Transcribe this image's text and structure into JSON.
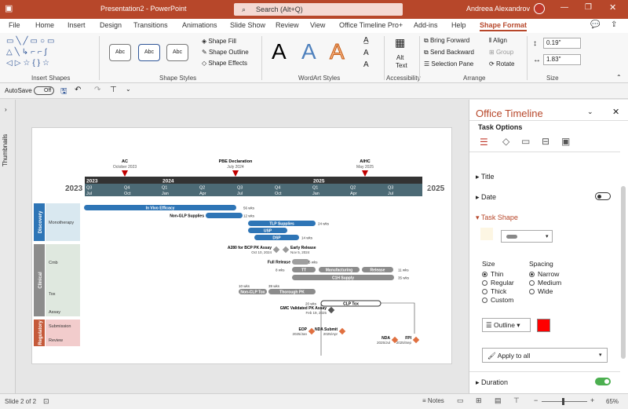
{
  "window": {
    "title": "Presentation2  -  PowerPoint",
    "search_placeholder": "Search (Alt+Q)",
    "user": "Andreea Alexandrov"
  },
  "tabs": [
    "File",
    "Home",
    "Insert",
    "Design",
    "Transitions",
    "Animations",
    "Slide Show",
    "Review",
    "View",
    "Office Timeline Pro+",
    "Add-ins",
    "Help",
    "Shape Format"
  ],
  "ribbon": {
    "groups": {
      "insert_shapes": "Insert Shapes",
      "shape_styles": "Shape Styles",
      "wordart_styles": "WordArt Styles",
      "accessibility": "Accessibility",
      "arrange": "Arrange",
      "size": "Size"
    },
    "style_sample": "Abc",
    "shape_fill": "Shape Fill",
    "shape_outline": "Shape Outline",
    "shape_effects": "Shape Effects",
    "wordart_letter": "A",
    "alt_text_1": "Alt",
    "alt_text_2": "Text",
    "bring_forward": "Bring Forward",
    "send_backward": "Send Backward",
    "selection_pane": "Selection Pane",
    "align": "Align",
    "group": "Group",
    "rotate": "Rotate",
    "height": "0.19\"",
    "width": "1.83\""
  },
  "qat": {
    "autosave": "AutoSave",
    "autosave_state": "Off"
  },
  "thumbnails_label": "Thumbnails",
  "timeline": {
    "year_left": "2023",
    "year_right": "2025",
    "years": [
      "2023",
      "2024",
      "2025"
    ],
    "quarters": [
      [
        "Q3",
        "Jul"
      ],
      [
        "Q4",
        "Oct"
      ],
      [
        "Q1",
        "Jan"
      ],
      [
        "Q2",
        "Apr"
      ],
      [
        "Q3",
        "Jul"
      ],
      [
        "Q4",
        "Oct"
      ],
      [
        "Q1",
        "Jan"
      ],
      [
        "Q2",
        "Apr"
      ],
      [
        "Q3",
        "Jul"
      ],
      [
        "Q4",
        "Oct"
      ]
    ],
    "milestones_top": [
      {
        "title": "AC",
        "date": "October 2023"
      },
      {
        "title": "PBE Declaration",
        "date": "July 2024"
      },
      {
        "title": "AIHC",
        "date": "May 2025"
      }
    ],
    "swimlanes": [
      {
        "name": "Discovery",
        "color": "#2e75b6"
      },
      {
        "name": "Clinical",
        "color": "#8c8c8c"
      },
      {
        "name": "Regulatory",
        "color": "#c55a3a"
      }
    ],
    "sublanes": [
      "Monotherapy",
      "Cmb",
      "Tox",
      "Assay",
      "Submission",
      "Review"
    ],
    "tasks": [
      {
        "label": "In Vivo Efficacy",
        "dur": "56 wks"
      },
      {
        "label": "Non-GLP Supplies",
        "dur": "12 wks"
      },
      {
        "label": "TLP Supplies",
        "dur": "24 wks"
      },
      {
        "label": "USP",
        "dur": ""
      },
      {
        "label": "DSP",
        "dur": "14 wks"
      },
      {
        "label": "Full Release",
        "dur": "5 wks"
      },
      {
        "label": "TT",
        "dur": "8 wks"
      },
      {
        "label": "Manufacturing",
        "dur": ""
      },
      {
        "label": "Release",
        "dur": "11 wks"
      },
      {
        "label": "C1H Supply",
        "dur": "35 wks"
      },
      {
        "label": "Non-CLP Tox",
        "dur": "10 wks"
      },
      {
        "label": "Thorough PK",
        "dur": "39 wks"
      },
      {
        "label": "CLP Tox",
        "dur": "20 wks"
      }
    ],
    "milestones": [
      {
        "title": "A280 for BCP PK Assay",
        "date": "Oct 10, 2024"
      },
      {
        "title": "Early Release",
        "date": "Nov 5, 2024"
      },
      {
        "title": "GMC Validated PK Assay",
        "date": "Feb 19, 2025"
      },
      {
        "title": "EOP",
        "date": "2025/Jan"
      },
      {
        "title": "NDA Submit",
        "date": "2025/Apr"
      },
      {
        "title": "NDA",
        "date": "2025/Jul"
      },
      {
        "title": "FPI",
        "date": "2025/Sep"
      }
    ]
  },
  "pane": {
    "title": "Office Timeline",
    "subtitle": "Task Options",
    "sections": {
      "title": "Title",
      "date": "Date",
      "task_shape": "Task Shape",
      "duration": "Duration"
    },
    "size_label": "Size",
    "spacing_label": "Spacing",
    "size_options": [
      "Thin",
      "Regular",
      "Thick",
      "Custom"
    ],
    "size_selected": "Thin",
    "spacing_options": [
      "Narrow",
      "Medium",
      "Wide"
    ],
    "spacing_selected": "Narrow",
    "outline_label": "Outline",
    "outline_color": "#ff0000",
    "apply_all": "Apply to all"
  },
  "status": {
    "slide": "Slide 2 of 2",
    "notes": "Notes",
    "zoom": "65%"
  }
}
